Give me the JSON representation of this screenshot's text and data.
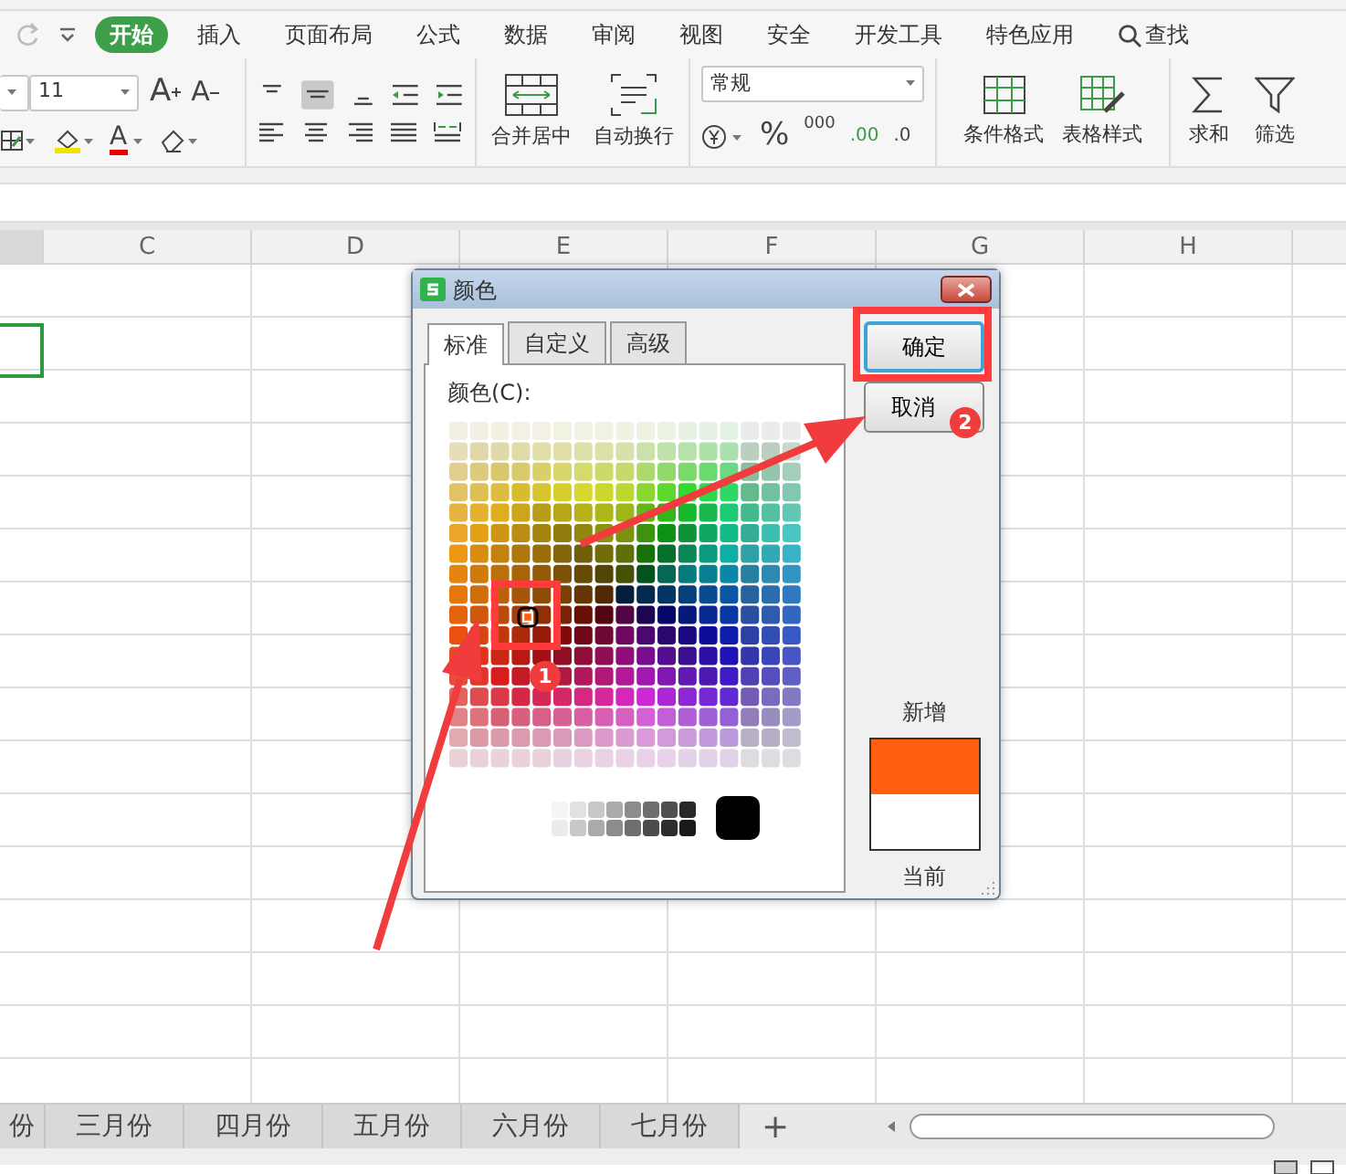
{
  "menu_tabs": [
    {
      "label": "开始",
      "selected": true,
      "kind": "tab"
    },
    {
      "label": "插入",
      "selected": false,
      "kind": "tab"
    },
    {
      "label": "页面布局",
      "selected": false,
      "kind": "tab"
    },
    {
      "label": "公式",
      "selected": false,
      "kind": "tab"
    },
    {
      "label": "数据",
      "selected": false,
      "kind": "tab"
    },
    {
      "label": "审阅",
      "selected": false,
      "kind": "tab"
    },
    {
      "label": "视图",
      "selected": false,
      "kind": "tab"
    },
    {
      "label": "安全",
      "selected": false,
      "kind": "tab"
    },
    {
      "label": "开发工具",
      "selected": false,
      "kind": "tab"
    },
    {
      "label": "特色应用",
      "selected": false,
      "kind": "tab"
    },
    {
      "label": "查找",
      "selected": false,
      "kind": "search"
    }
  ],
  "ribbon": {
    "font_size": "11",
    "font_grow": "A",
    "font_shrink": "A",
    "font_color": "A",
    "merge_button": "合并居中",
    "wrap_button": "自动换行",
    "number_format": "常规",
    "percent": "%",
    "thousands": "000",
    "decimal_increase": ".00",
    "decimal_decrease": ".0",
    "conditional_format": "条件格式",
    "table_style": "表格样式",
    "sum": "求和",
    "filter": "筛选"
  },
  "columns": [
    "C",
    "D",
    "E",
    "F",
    "G",
    "H"
  ],
  "sheet_tabs": [
    {
      "label": "份",
      "selected": false
    },
    {
      "label": "三月份",
      "selected": false
    },
    {
      "label": "四月份",
      "selected": false
    },
    {
      "label": "五月份",
      "selected": false
    },
    {
      "label": "六月份",
      "selected": false
    },
    {
      "label": "七月份",
      "selected": false
    }
  ],
  "add_sheet": "+",
  "dialog": {
    "title": "颜色",
    "tabs": [
      {
        "label": "标准",
        "selected": true
      },
      {
        "label": "自定义",
        "selected": false
      },
      {
        "label": "高级",
        "selected": false
      }
    ],
    "palette_label": "颜色(C):",
    "buttons": [
      {
        "label": "确定",
        "default": true
      },
      {
        "label": "取消",
        "default": false
      }
    ],
    "new_label": "新增",
    "preview": [
      {
        "color": "#ff5f0e"
      },
      {
        "color": "#ffffff"
      }
    ],
    "current_label": "当前"
  },
  "annotations": [
    {
      "label": "1"
    },
    {
      "label": "2"
    }
  ]
}
